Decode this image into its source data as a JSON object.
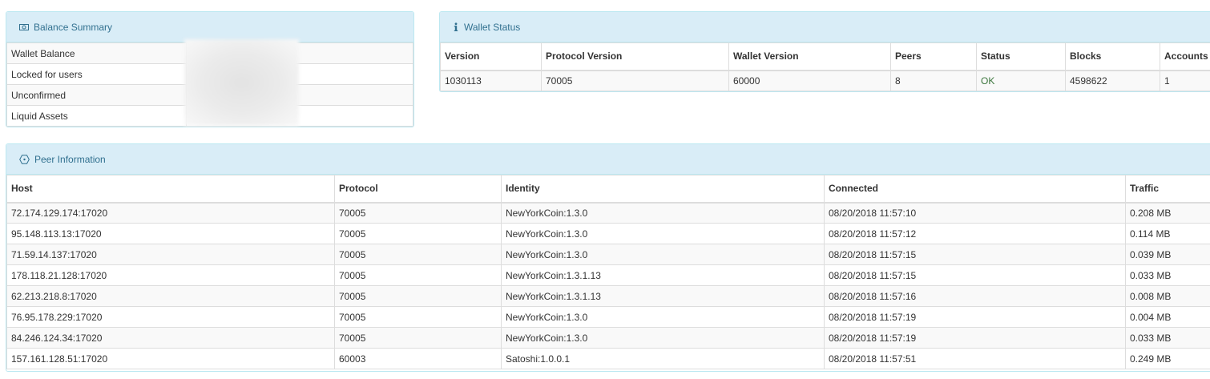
{
  "balance_summary": {
    "title": "Balance Summary",
    "icon": "money-icon",
    "rows": [
      {
        "label": "Wallet Balance"
      },
      {
        "label": "Locked for users"
      },
      {
        "label": "Unconfirmed"
      },
      {
        "label": "Liquid Assets"
      }
    ]
  },
  "wallet_status": {
    "title": "Wallet Status",
    "icon": "info-icon",
    "columns": [
      "Version",
      "Protocol Version",
      "Wallet Version",
      "Peers",
      "Status",
      "Blocks",
      "Accounts"
    ],
    "row": [
      "1030113",
      "70005",
      "60000",
      "8",
      "OK",
      "4598622",
      "1"
    ],
    "status_color": "#3c763d"
  },
  "peer_information": {
    "title": "Peer Information",
    "icon": "network-icon",
    "columns": [
      "Host",
      "Protocol",
      "Identity",
      "Connected",
      "Traffic"
    ],
    "rows": [
      [
        "72.174.129.174:17020",
        "70005",
        "NewYorkCoin:1.3.0",
        "08/20/2018 11:57:10",
        "0.208 MB"
      ],
      [
        "95.148.113.13:17020",
        "70005",
        "NewYorkCoin:1.3.0",
        "08/20/2018 11:57:12",
        "0.114 MB"
      ],
      [
        "71.59.14.137:17020",
        "70005",
        "NewYorkCoin:1.3.0",
        "08/20/2018 11:57:15",
        "0.039 MB"
      ],
      [
        "178.118.21.128:17020",
        "70005",
        "NewYorkCoin:1.3.1.13",
        "08/20/2018 11:57:15",
        "0.033 MB"
      ],
      [
        "62.213.218.8:17020",
        "70005",
        "NewYorkCoin:1.3.1.13",
        "08/20/2018 11:57:16",
        "0.008 MB"
      ],
      [
        "76.95.178.229:17020",
        "70005",
        "NewYorkCoin:1.3.0",
        "08/20/2018 11:57:19",
        "0.004 MB"
      ],
      [
        "84.246.124.34:17020",
        "70005",
        "NewYorkCoin:1.3.0",
        "08/20/2018 11:57:19",
        "0.033 MB"
      ],
      [
        "157.161.128.51:17020",
        "60003",
        "Satoshi:1.0.0.1",
        "08/20/2018 11:57:51",
        "0.249 MB"
      ]
    ]
  },
  "colors": {
    "panel_heading_bg": "#d9edf7",
    "panel_heading_text": "#31708f",
    "panel_border": "#bce8f1"
  }
}
